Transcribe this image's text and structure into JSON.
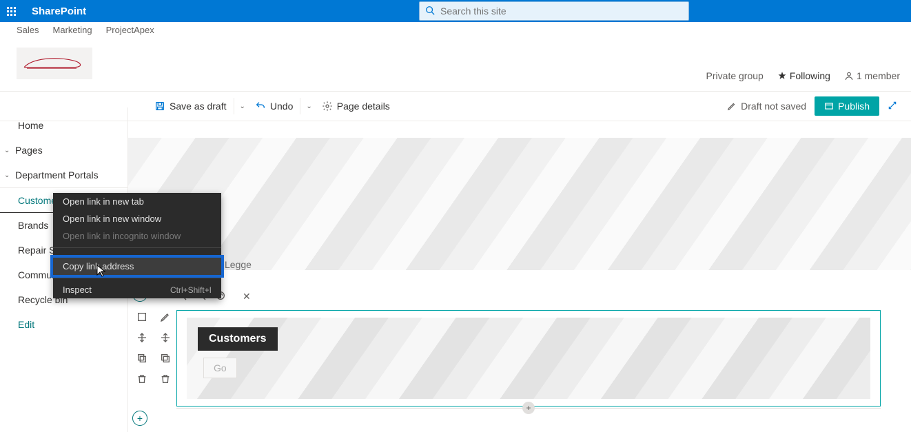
{
  "header": {
    "appName": "SharePoint",
    "searchPlaceholder": "Search this site"
  },
  "hubNav": [
    "Sales",
    "Marketing",
    "ProjectApex"
  ],
  "groupInfo": {
    "privacy": "Private group",
    "following": "Following",
    "members": "1 member"
  },
  "commandBar": {
    "saveDraft": "Save as draft",
    "undo": "Undo",
    "pageDetails": "Page details",
    "draftStatus": "Draft not saved",
    "publish": "Publish"
  },
  "leftNav": {
    "home": "Home",
    "pages": "Pages",
    "deptPortals": "Department Portals",
    "customers": "Customers",
    "brands": "Brands",
    "repairShops": "Repair Shops",
    "community": "Community",
    "recycle": "Recycle bin",
    "edit": "Edit"
  },
  "hero": {
    "authorFragment": "Legge"
  },
  "webpart": {
    "title": "Customers",
    "go": "Go"
  },
  "contextMenu": {
    "openNewTab": "Open link in new tab",
    "openNewWindow": "Open link in new window",
    "openIncognito": "Open link in incognito window",
    "copyLink": "Copy link address",
    "inspect": "Inspect",
    "inspectShortcut": "Ctrl+Shift+I"
  }
}
